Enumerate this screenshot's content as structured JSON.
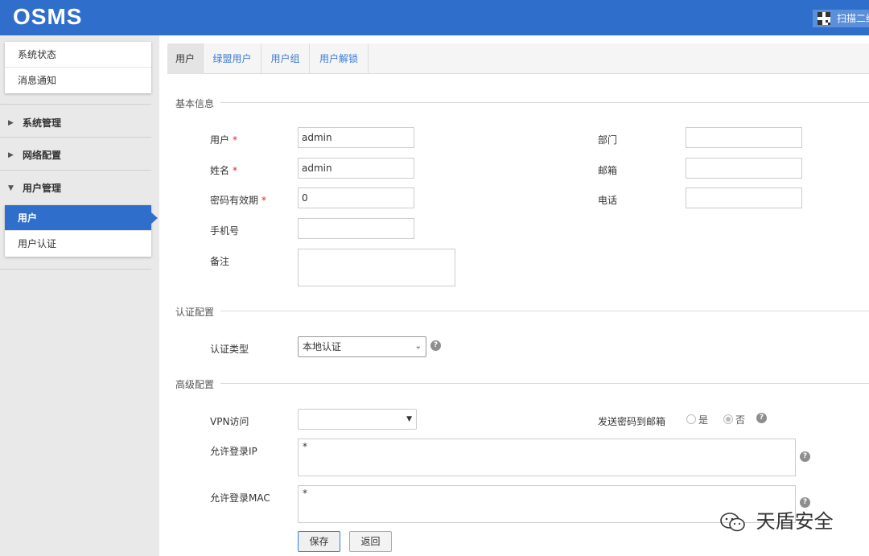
{
  "header": {
    "logo": "OSMS",
    "qr_text": "扫描二维"
  },
  "sidebar": {
    "top_items": [
      {
        "label": "系统状态"
      },
      {
        "label": "消息通知"
      }
    ],
    "groups": [
      {
        "label": "系统管理",
        "expanded": false
      },
      {
        "label": "网络配置",
        "expanded": false
      },
      {
        "label": "用户管理",
        "expanded": true
      }
    ],
    "sub_items": [
      {
        "label": "用户",
        "active": true
      },
      {
        "label": "用户认证",
        "active": false
      }
    ]
  },
  "tabs": [
    {
      "label": "用户",
      "active": true
    },
    {
      "label": "绿盟用户",
      "active": false
    },
    {
      "label": "用户组",
      "active": false
    },
    {
      "label": "用户解锁",
      "active": false
    }
  ],
  "basic": {
    "title": "基本信息",
    "user_label": "用户",
    "user_value": "admin",
    "name_label": "姓名",
    "name_value": "admin",
    "pwd_expiry_label": "密码有效期",
    "pwd_expiry_value": "0",
    "mobile_label": "手机号",
    "mobile_value": "",
    "remark_label": "备注",
    "remark_value": "",
    "dept_label": "部门",
    "dept_value": "",
    "email_label": "邮箱",
    "email_value": "",
    "phone_label": "电话",
    "phone_value": "",
    "required_mark": "*"
  },
  "auth": {
    "title": "认证配置",
    "type_label": "认证类型",
    "type_value": "本地认证"
  },
  "advanced": {
    "title": "高级配置",
    "vpn_label": "VPN访问",
    "vpn_value": "",
    "send_pwd_label": "发送密码到邮箱",
    "yes_label": "是",
    "no_label": "否",
    "send_pwd_selected": "否",
    "allow_ip_label": "允许登录IP",
    "allow_ip_value": "*",
    "allow_mac_label": "允许登录MAC",
    "allow_mac_value": "*"
  },
  "actions": {
    "save": "保存",
    "back": "返回"
  },
  "watermark": "天盾安全",
  "colors": {
    "brand": "#2f6fcb",
    "tab_link": "#3a7bd5",
    "required": "#d9282f"
  }
}
